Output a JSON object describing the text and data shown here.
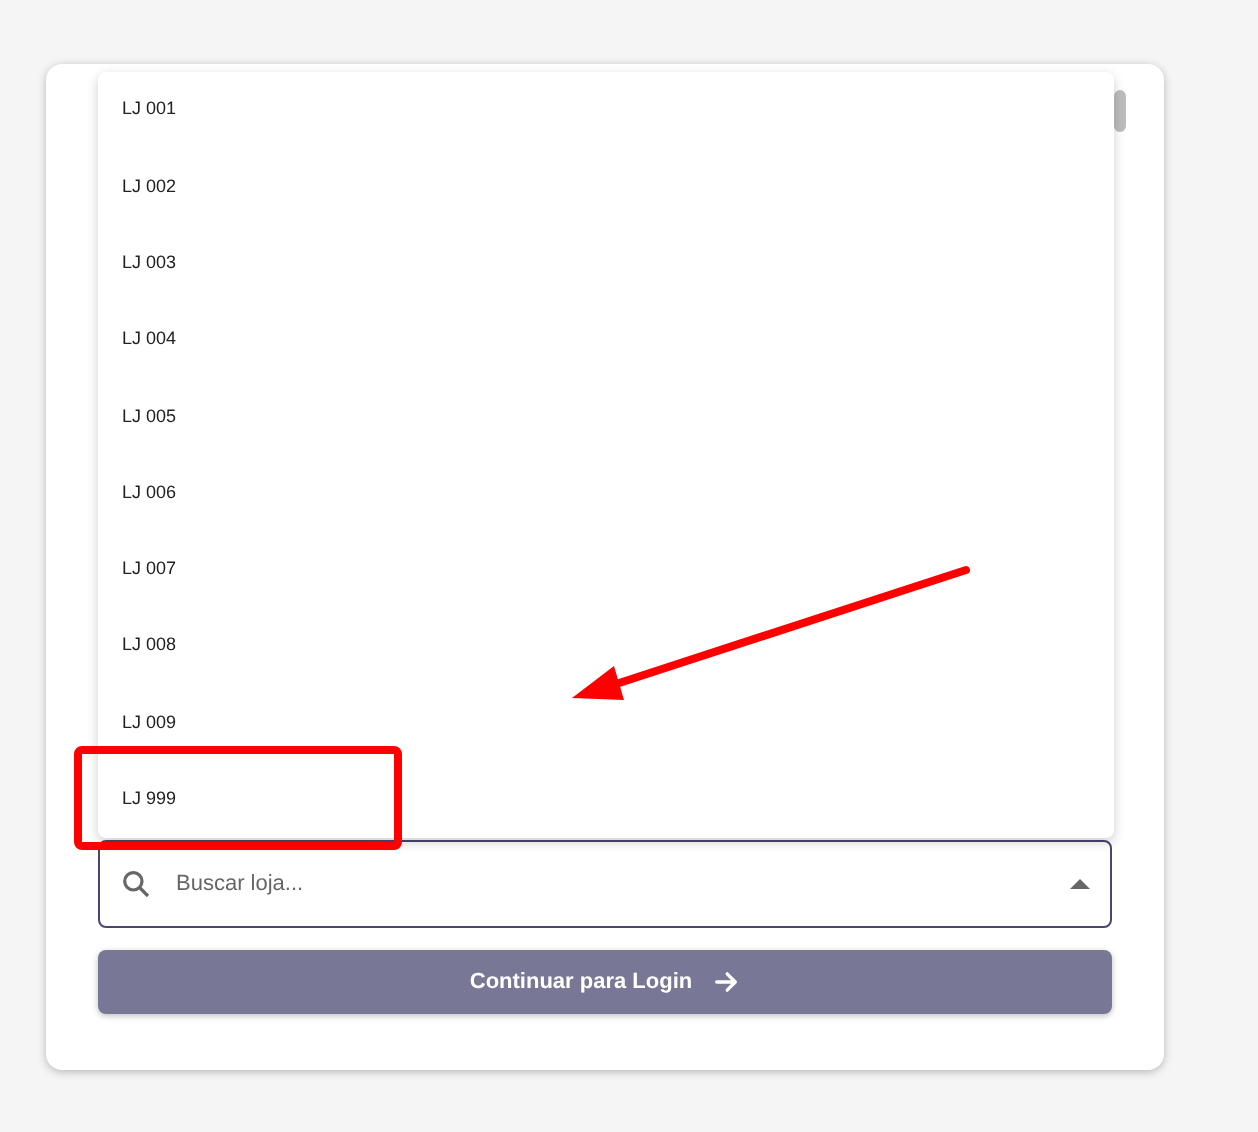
{
  "store_picker": {
    "expanded": true,
    "options": [
      {
        "label": "LJ 001"
      },
      {
        "label": "LJ 002"
      },
      {
        "label": "LJ 003"
      },
      {
        "label": "LJ 004"
      },
      {
        "label": "LJ 005"
      },
      {
        "label": "LJ 006"
      },
      {
        "label": "LJ 007"
      },
      {
        "label": "LJ 008"
      },
      {
        "label": "LJ 009"
      },
      {
        "label": "LJ 999"
      }
    ],
    "search": {
      "placeholder": "Buscar loja..."
    }
  },
  "continue_button": {
    "label": "Continuar para Login"
  }
}
